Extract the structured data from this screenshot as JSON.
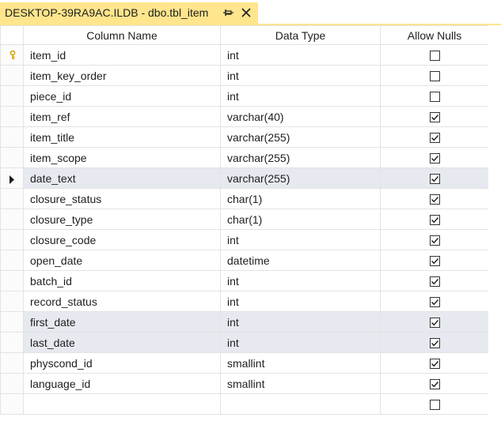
{
  "tab": {
    "title": "DESKTOP-39RA9AC.ILDB - dbo.tbl_item",
    "pin_icon": "pin-icon",
    "close_icon": "close-icon"
  },
  "columns": {
    "name": "Column Name",
    "type": "Data Type",
    "nulls": "Allow Nulls"
  },
  "rows": [
    {
      "name": "item_id",
      "type": "int",
      "allow_nulls": false,
      "key": true
    },
    {
      "name": "item_key_order",
      "type": "int",
      "allow_nulls": false
    },
    {
      "name": "piece_id",
      "type": "int",
      "allow_nulls": false
    },
    {
      "name": "item_ref",
      "type": "varchar(40)",
      "allow_nulls": true
    },
    {
      "name": "item_title",
      "type": "varchar(255)",
      "allow_nulls": true
    },
    {
      "name": "item_scope",
      "type": "varchar(255)",
      "allow_nulls": true
    },
    {
      "name": "date_text",
      "type": "varchar(255)",
      "allow_nulls": true,
      "current": true
    },
    {
      "name": "closure_status",
      "type": "char(1)",
      "allow_nulls": true
    },
    {
      "name": "closure_type",
      "type": "char(1)",
      "allow_nulls": true
    },
    {
      "name": "closure_code",
      "type": "int",
      "allow_nulls": true
    },
    {
      "name": "open_date",
      "type": "datetime",
      "allow_nulls": true
    },
    {
      "name": "batch_id",
      "type": "int",
      "allow_nulls": true
    },
    {
      "name": "record_status",
      "type": "int",
      "allow_nulls": true
    },
    {
      "name": "first_date",
      "type": "int",
      "allow_nulls": true,
      "highlight": true
    },
    {
      "name": "last_date",
      "type": "int",
      "allow_nulls": true,
      "highlight": true
    },
    {
      "name": "physcond_id",
      "type": "smallint",
      "allow_nulls": true
    },
    {
      "name": "language_id",
      "type": "smallint",
      "allow_nulls": true
    },
    {
      "name": "",
      "type": "",
      "allow_nulls": false
    }
  ],
  "colors": {
    "tab_active": "#ffe58c",
    "row_highlight": "#e6e9ef",
    "key_icon": "#d4a800"
  }
}
